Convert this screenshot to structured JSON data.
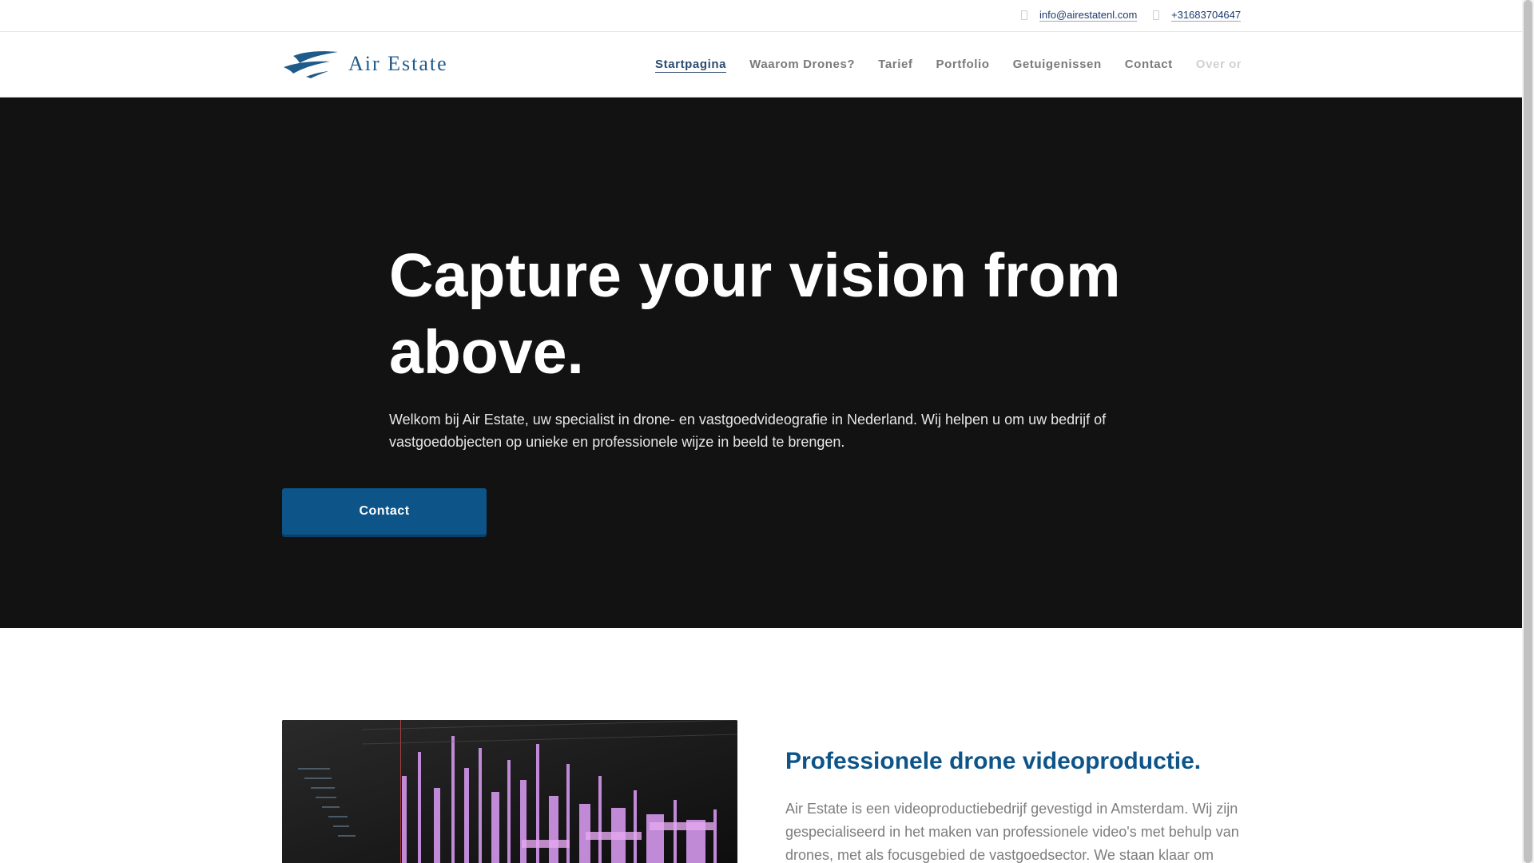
{
  "topbar": {
    "email": "info@airestatenl.com",
    "phone": "+31683704647"
  },
  "header": {
    "brand": "Air Estate",
    "logo_icon": "waves-logo-icon",
    "nav": [
      {
        "label": "Startpagina",
        "active": true
      },
      {
        "label": "Waarom Drones?"
      },
      {
        "label": "Tarief"
      },
      {
        "label": "Portfolio"
      },
      {
        "label": "Getuigenissen"
      },
      {
        "label": "Contact"
      },
      {
        "label": "Over ons"
      }
    ]
  },
  "hero": {
    "title": "Capture your vision from above.",
    "text": "Welkom bij Air Estate, uw specialist in drone- en vastgoedvideografie in Nederland. Wij helpen u om uw bedrijf of vastgoedobjecten op unieke en professionele wijze in beeld te brengen.",
    "button_label": "Contact"
  },
  "about": {
    "title": "Professionele drone videoproductie.",
    "text": "Air Estate is een videoproductiebedrijf gevestigd in Amsterdam. Wij zijn gespecialiseerd in het maken van professionele video's met behulp van drones, met als focusgebied de vastgoedsector. We staan klaar om"
  },
  "colors": {
    "brand": "#0d5489",
    "hero_bg": "#121212",
    "nav_active": "#2b4a6e"
  }
}
